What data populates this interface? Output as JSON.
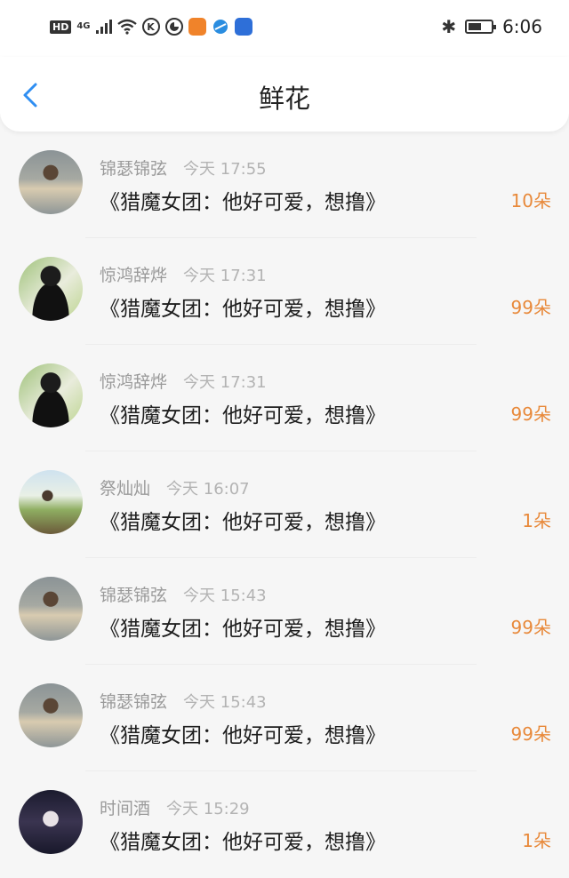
{
  "status_bar": {
    "hd": "HD",
    "network": "4G",
    "k_icon": "K",
    "time": "6:06"
  },
  "header": {
    "title": "鲜花",
    "back_icon": "chevron-left-icon"
  },
  "colors": {
    "accent": "#2f8ef2",
    "count": "#e8893a",
    "meta": "#9a9a9a"
  },
  "items": [
    {
      "name": "锦瑟锦弦",
      "time": "今天 17:55",
      "message": "《猎魔女团：他好可爱，想撸》",
      "count": "10朵",
      "avatar": "avatar-girl-dress"
    },
    {
      "name": "惊鸿辞烨",
      "time": "今天 17:31",
      "message": "《猎魔女团：他好可爱，想撸》",
      "count": "99朵",
      "avatar": "avatar-boy-black"
    },
    {
      "name": "惊鸿辞烨",
      "time": "今天 17:31",
      "message": "《猎魔女团：他好可爱，想撸》",
      "count": "99朵",
      "avatar": "avatar-boy-black"
    },
    {
      "name": "祭灿灿",
      "time": "今天 16:07",
      "message": "《猎魔女团：他好可爱，想撸》",
      "count": "1朵",
      "avatar": "avatar-runner"
    },
    {
      "name": "锦瑟锦弦",
      "time": "今天 15:43",
      "message": "《猎魔女团：他好可爱，想撸》",
      "count": "99朵",
      "avatar": "avatar-girl-dress"
    },
    {
      "name": "锦瑟锦弦",
      "time": "今天 15:43",
      "message": "《猎魔女团：他好可爱，想撸》",
      "count": "99朵",
      "avatar": "avatar-girl-dress"
    },
    {
      "name": "时间酒",
      "time": "今天 15:29",
      "message": "《猎魔女团：他好可爱，想撸》",
      "count": "1朵",
      "avatar": "avatar-dark-girl"
    }
  ]
}
